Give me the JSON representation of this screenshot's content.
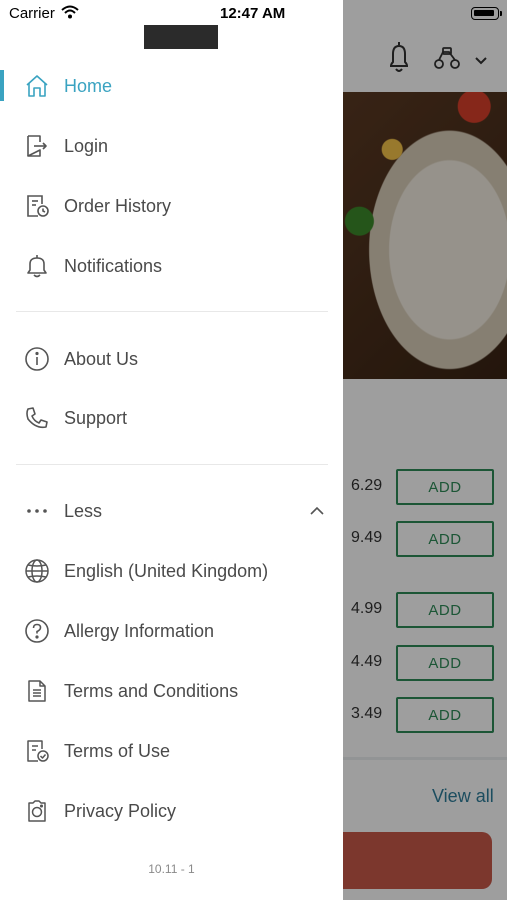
{
  "status_bar": {
    "carrier": "Carrier",
    "time": "12:47 AM"
  },
  "menu": {
    "home": "Home",
    "login": "Login",
    "order_history": "Order History",
    "notifications": "Notifications",
    "about_us": "About Us",
    "support": "Support",
    "less": "Less",
    "language": "English (United Kingdom)",
    "allergy": "Allergy Information",
    "terms_conditions": "Terms and Conditions",
    "terms_use": "Terms of Use",
    "privacy": "Privacy Policy"
  },
  "version": "10.11 - 1",
  "background": {
    "items": [
      {
        "price": "6.29",
        "add_label": "ADD"
      },
      {
        "price": "9.49",
        "add_label": "ADD"
      },
      {
        "price": "4.99",
        "add_label": "ADD"
      },
      {
        "price": "4.49",
        "add_label": "ADD"
      },
      {
        "price": "3.49",
        "add_label": "ADD"
      }
    ],
    "view_all": "View all"
  },
  "colors": {
    "accent": "#3aa3c1",
    "add_green": "#2e8b57",
    "cta": "#c8594a"
  },
  "icons": [
    "home-icon",
    "login-icon",
    "order-history-icon",
    "bell-icon",
    "info-icon",
    "phone-icon",
    "more-dots-icon",
    "chevron-up-icon",
    "globe-icon",
    "question-icon",
    "document-icon",
    "document-check-icon",
    "privacy-icon",
    "wifi-icon",
    "battery-icon",
    "scooter-icon",
    "chevron-down-icon"
  ]
}
